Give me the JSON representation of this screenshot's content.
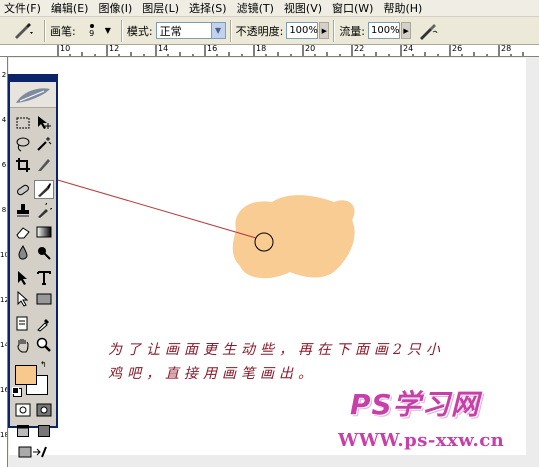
{
  "menu": [
    {
      "label": "文件(F)"
    },
    {
      "label": "编辑(E)"
    },
    {
      "label": "图像(I)"
    },
    {
      "label": "图层(L)"
    },
    {
      "label": "选择(S)"
    },
    {
      "label": "滤镜(T)"
    },
    {
      "label": "视图(V)"
    },
    {
      "label": "窗口(W)"
    },
    {
      "label": "帮助(H)"
    }
  ],
  "options": {
    "brush_label": "画笔:",
    "brush_size": "9",
    "mode_label": "模式:",
    "mode_value": "正常",
    "opacity_label": "不透明度:",
    "opacity_value": "100%",
    "flow_label": "流量:",
    "flow_value": "100%"
  },
  "ruler_top_labels": [
    "10",
    "12",
    "14",
    "16",
    "18",
    "20",
    "22",
    "24",
    "26",
    "28",
    "30"
  ],
  "ruler_left_labels": [
    "2",
    "4",
    "6",
    "8",
    "10",
    "12",
    "14",
    "16",
    "18"
  ],
  "canvas": {
    "blob_color": "#f8c98d",
    "line_color": "#b83a3a"
  },
  "colors": {
    "foreground": "#f8c98d",
    "background": "#ffffff"
  },
  "note": {
    "line1": "为了让画面更生动些，再在下面画2只小",
    "line2": "鸡吧，直接用画笔画出。"
  },
  "watermark": {
    "logo": "PS学习网",
    "url": "WWW.ps-xxw.cn"
  }
}
